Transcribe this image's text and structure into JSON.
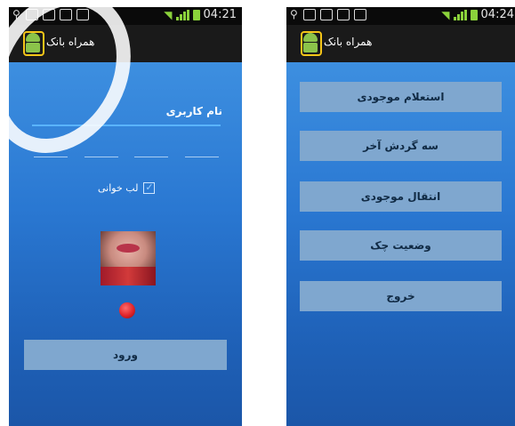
{
  "left_screen": {
    "status": {
      "time": "04:21"
    },
    "app_title": "همراه بانک",
    "username_label": "نام کاربری",
    "lip_reading_label": "لب خوانی",
    "lip_reading_checked": true,
    "login_button": "ورود"
  },
  "right_screen": {
    "status": {
      "time": "04:24"
    },
    "app_title": "همراه بانک",
    "menu": [
      {
        "label": "استعلام موجودی"
      },
      {
        "label": "سه گردش آخر"
      },
      {
        "label": "انتقال موجودی"
      },
      {
        "label": "وضعیت چک"
      },
      {
        "label": "خروج"
      }
    ]
  },
  "icons": {
    "status_left": [
      "usb-icon",
      "notification-icon",
      "image-icon",
      "voicemail-icon",
      "bag-icon"
    ],
    "status_right": [
      "wifi-icon",
      "signal-icon",
      "battery-icon"
    ],
    "app": "android-app-icon"
  },
  "colors": {
    "screen_top": "#3d8fe0",
    "screen_bottom": "#1b56a8",
    "button": "#7fa7cf",
    "status_green": "#8bd23b",
    "input_underline": "#5ab4ff"
  }
}
